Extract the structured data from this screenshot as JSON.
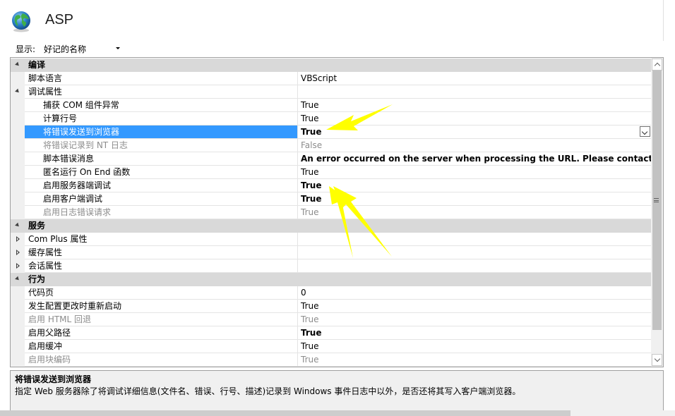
{
  "header": {
    "title": "ASP",
    "icon": "globe-icon"
  },
  "view": {
    "label": "显示:",
    "selected": "好记的名称"
  },
  "grid": {
    "rows": [
      {
        "type": "cat",
        "label": "编译",
        "expand": "open"
      },
      {
        "type": "prop",
        "level": 1,
        "name": "脚本语言",
        "value": "VBScript"
      },
      {
        "type": "sub",
        "level": 1,
        "name": "调试属性",
        "expand": "open",
        "value": ""
      },
      {
        "type": "prop",
        "level": 2,
        "name": "捕获 COM 组件异常",
        "value": "True"
      },
      {
        "type": "prop",
        "level": 2,
        "name": "计算行号",
        "value": "True"
      },
      {
        "type": "prop",
        "level": 2,
        "name": "将错误发送到浏览器",
        "value": "True",
        "bold": true,
        "selected": true
      },
      {
        "type": "prop",
        "level": 2,
        "name": "将错误记录到 NT 日志",
        "value": "False",
        "disabled": true
      },
      {
        "type": "prop",
        "level": 2,
        "name": "脚本错误消息",
        "value": "An error occurred on the server when processing the URL. Please contact the syst",
        "bold": true
      },
      {
        "type": "prop",
        "level": 2,
        "name": "匿名运行 On End 函数",
        "value": "True"
      },
      {
        "type": "prop",
        "level": 2,
        "name": "启用服务器端调试",
        "value": "True",
        "bold": true
      },
      {
        "type": "prop",
        "level": 2,
        "name": "启用客户端调试",
        "value": "True",
        "bold": true
      },
      {
        "type": "prop",
        "level": 2,
        "name": "启用日志错误请求",
        "value": "True",
        "disabled": true
      },
      {
        "type": "cat",
        "label": "服务",
        "expand": "open"
      },
      {
        "type": "sub",
        "level": 1,
        "name": "Com Plus 属性",
        "expand": "closed",
        "value": ""
      },
      {
        "type": "sub",
        "level": 1,
        "name": "缓存属性",
        "expand": "closed",
        "value": ""
      },
      {
        "type": "sub",
        "level": 1,
        "name": "会话属性",
        "expand": "closed",
        "value": ""
      },
      {
        "type": "cat",
        "label": "行为",
        "expand": "open"
      },
      {
        "type": "prop",
        "level": 1,
        "name": "代码页",
        "value": "0"
      },
      {
        "type": "prop",
        "level": 1,
        "name": "发生配置更改时重新启动",
        "value": "True"
      },
      {
        "type": "prop",
        "level": 1,
        "name": "启用 HTML 回退",
        "value": "True",
        "disabled": true
      },
      {
        "type": "prop",
        "level": 1,
        "name": "启用父路径",
        "value": "True",
        "bold": true
      },
      {
        "type": "prop",
        "level": 1,
        "name": "启用缓冲",
        "value": "True"
      },
      {
        "type": "prop",
        "level": 1,
        "name": "启用块编码",
        "value": "True",
        "disabled": true
      }
    ]
  },
  "description": {
    "title": "将错误发送到浏览器",
    "text": "指定 Web 服务器除了将调试详细信息(文件名、错误、行号、描述)记录到 Windows 事件日志中以外，是否还将其写入客户端浏览器。"
  },
  "annotations": {
    "arrow_color": "#ffff00"
  },
  "colors": {
    "selection": "#3399ff",
    "category_bg": "#d9d9d9"
  }
}
